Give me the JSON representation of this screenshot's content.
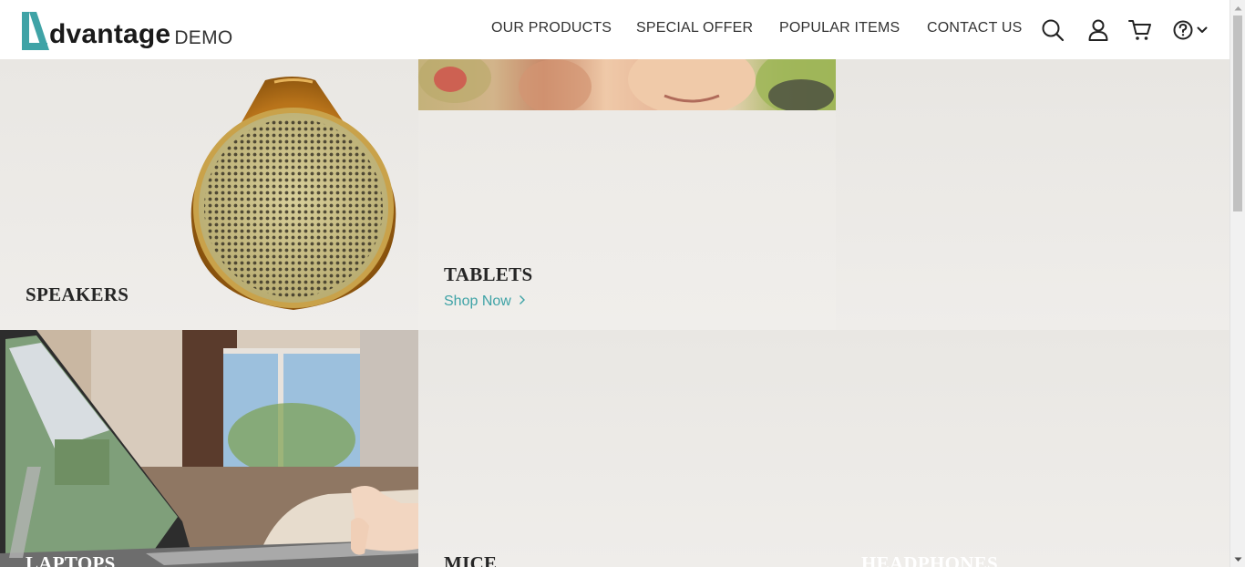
{
  "brand": {
    "name": "dvantage",
    "suffix": "DEMO",
    "accent": "#3fa3a6"
  },
  "nav": {
    "items": [
      {
        "label": "OUR PRODUCTS"
      },
      {
        "label": "SPECIAL OFFER"
      },
      {
        "label": "POPULAR ITEMS"
      },
      {
        "label": "CONTACT US"
      }
    ]
  },
  "header_icons": [
    "search-icon",
    "user-icon",
    "cart-icon",
    "help-icon",
    "chevron-down-icon"
  ],
  "categories": {
    "speakers": {
      "title": "SPEAKERS"
    },
    "tablets": {
      "title": "TABLETS",
      "cta": "Shop Now"
    },
    "laptops": {
      "title": "LAPTOPS"
    },
    "mice": {
      "title": "MICE"
    },
    "headphones": {
      "title": "HEADPHONES"
    }
  }
}
